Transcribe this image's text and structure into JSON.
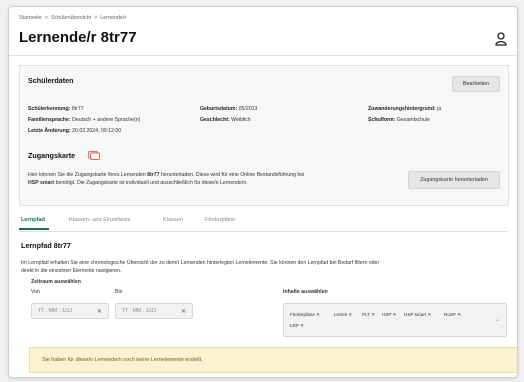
{
  "breadcrumb": [
    "Startseite",
    "Schülerübersicht",
    "Lernende/r"
  ],
  "page_title": "Lernende/r 8tr77",
  "student_data": {
    "heading": "Schülerdaten",
    "edit_button": "Bearbeiten",
    "fields": [
      {
        "label": "Schülerkennung:",
        "value": "8tr77"
      },
      {
        "label": "Geburtsdatum:",
        "value": "05/2013"
      },
      {
        "label": "Zuwanderungshintergrund:",
        "value": "ja"
      },
      {
        "label": "Familiensprache:",
        "value": "Deutsch + andere Sprache(n)"
      },
      {
        "label": "Geschlecht:",
        "value": "Weiblich"
      },
      {
        "label": "Schulform:",
        "value": "Gesamtschule"
      },
      {
        "label": "Letzte Änderung:",
        "value": "20.02.2024, 09:12:00"
      }
    ]
  },
  "access_card": {
    "heading": "Zugangskarte",
    "text_line1_a": "Hier können Sie die Zugangskarte Ihres Lernenden ",
    "text_line1_id": "8tr77",
    "text_line1_b": " herunterladen. Diese wird für eine Online Bestandsführung bei",
    "text_line2_bold": "HSP smart",
    "text_line2_b": " benötigt. Die Zugangskarte ist individuell und ausschließlich für diese/n Lernende/n.",
    "download_button": "Zugangskarte herunterladen"
  },
  "tabs": [
    "Lernpfad",
    "Klassen- und Einzeltests",
    "Klassen",
    "Förderpläne"
  ],
  "learning_path": {
    "heading": "Lernpfad 8tr77",
    "desc_line1": "Im Lernpfad erhalten Sie eine chronologische Übersicht der zu dem/r Lernenden hinterlegten Lernelemente. Sie können den Lernpfad bei Bedarf filtern oder",
    "desc_line2": "direkt in die einzelnen Elemente navigieren.",
    "period_label": "Zeitraum auswählen",
    "from_label": "Von",
    "to_label": "Bis",
    "date_placeholder": "TT . MM . JJJJ",
    "content_label": "Inhalte auswählen",
    "chips": [
      "Förderpläne",
      "LeSek",
      "PLT",
      "HSP",
      "HSP smart",
      "RoSP",
      "LRP"
    ],
    "empty_notice": "Sie haben für diese/n Lernende/n noch keine Lernelemente erstellt."
  }
}
